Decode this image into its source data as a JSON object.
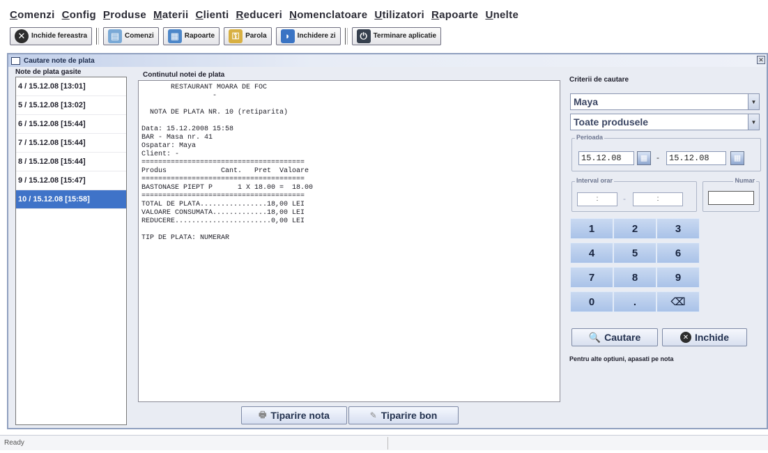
{
  "menu": [
    "Comenzi",
    "Config",
    "Produse",
    "Materii",
    "Clienti",
    "Reduceri",
    "Nomenclatoare",
    "Utilizatori",
    "Rapoarte",
    "Unelte"
  ],
  "toolbar": {
    "close_window": "Inchide fereastra",
    "orders": "Comenzi",
    "reports": "Rapoarte",
    "password": "Parola",
    "day_close": "Inchidere zi",
    "exit_app": "Terminare aplicatie"
  },
  "frame": {
    "title": "Cautare note de plata"
  },
  "list": {
    "header": "Note de plata gasite",
    "rows": [
      "4 / 15.12.08 [13:01]",
      "5 / 15.12.08 [13:02]",
      "6 / 15.12.08 [15:44]",
      "7 / 15.12.08 [15:44]",
      "8 / 15.12.08 [15:44]",
      "9 / 15.12.08 [15:47]",
      "10 / 15.12.08 [15:58]"
    ],
    "selected_index": 6
  },
  "content": {
    "header": "Continutul notei de plata",
    "receipt_lines": [
      "       RESTAURANT MOARA DE FOC",
      "                 -",
      "",
      "  NOTA DE PLATA NR. 10 (retiparita)",
      "",
      "Data: 15.12.2008 15:58",
      "BAR - Masa nr. 41",
      "Ospatar: Maya",
      "Client: -",
      "=======================================",
      "Produs             Cant.   Pret  Valoare",
      "=======================================",
      "BASTONASE PIEPT P      1 X 18.00 =  18.00",
      "=======================================",
      "TOTAL DE PLATA................18,00 LEI",
      "VALOARE CONSUMATA.............18,00 LEI",
      "REDUCERE.......................0,00 LEI",
      "",
      "TIP DE PLATA: NUMERAR"
    ],
    "print_note": "Tiparire nota",
    "print_receipt": "Tiparire bon"
  },
  "criteria": {
    "header": "Criterii de cautare",
    "waiter": "Maya",
    "products": "Toate produsele",
    "period_label": "Perioada",
    "date_from": "15.12.08",
    "date_to": "15.12.08",
    "date_sep": "-",
    "interval_label": "Interval orar",
    "time_from": ":",
    "time_to": ":",
    "time_sep": "-",
    "number_label": "Numar",
    "number_value": "",
    "keypad": [
      "1",
      "2",
      "3",
      "4",
      "5",
      "6",
      "7",
      "8",
      "9",
      "0",
      ".",
      "⌫"
    ],
    "search_button": "Cautare",
    "close_button": "Inchide",
    "hint": "Pentru alte optiuni, apasati pe nota"
  },
  "status": {
    "text": "Ready"
  }
}
